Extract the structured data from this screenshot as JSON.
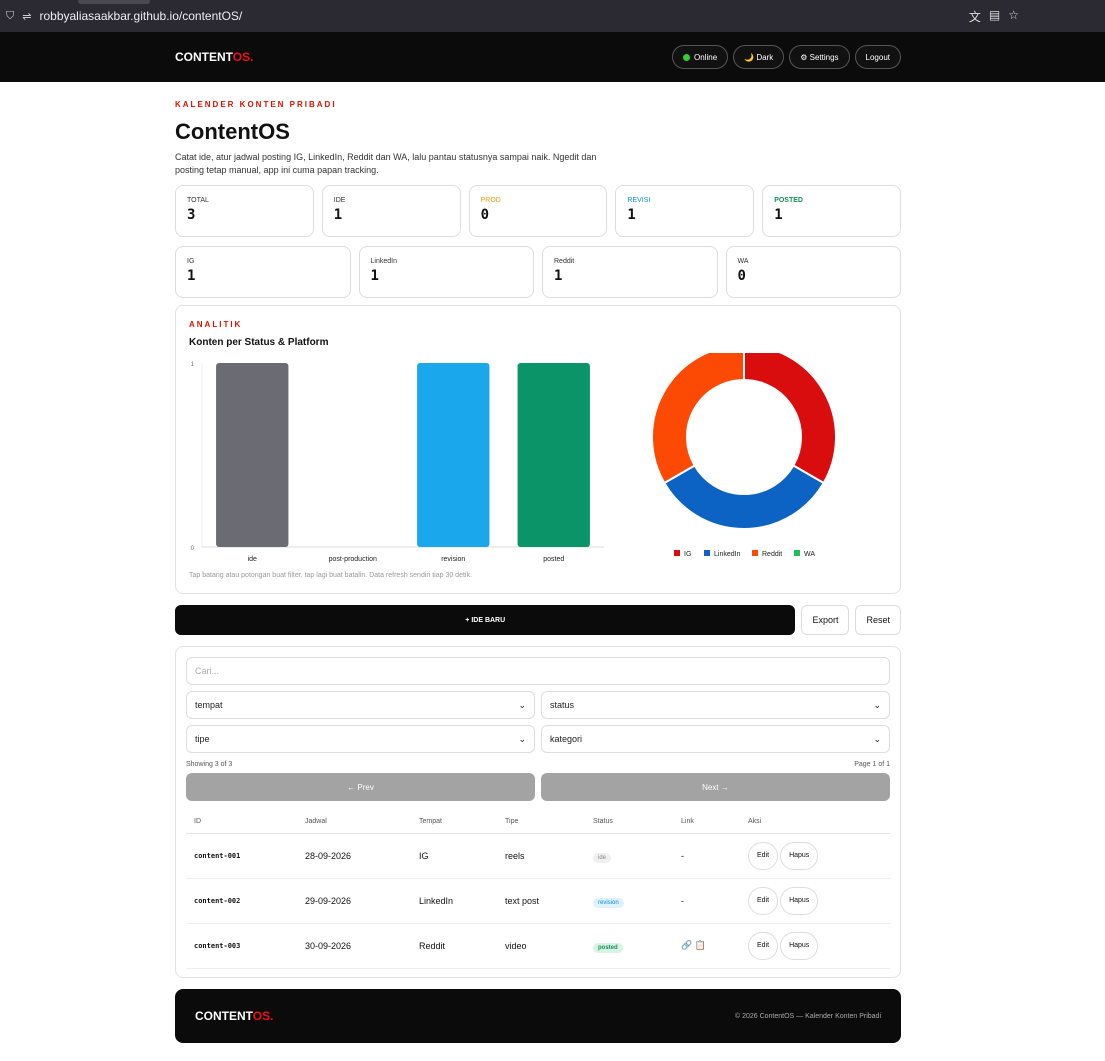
{
  "browser": {
    "url": "robbyaliasaakbar.github.io/contentOS/"
  },
  "nav": {
    "brand_main": "CONTENT",
    "brand_accent": "OS.",
    "online": "Online",
    "dark": "🌙 Dark",
    "settings": "⚙ Settings",
    "logout": "Logout"
  },
  "hero": {
    "eyebrow": "KALENDER KONTEN PRIBADI",
    "title": "ContentOS",
    "desc": "Catat ide, atur jadwal posting IG, LinkedIn, Reddit dan WA, lalu pantau statusnya sampai naik. Ngedit dan posting tetap manual, app ini cuma papan tracking."
  },
  "stats": [
    {
      "label": "TOTAL",
      "value": "3",
      "color": "#333333"
    },
    {
      "label": "IDE",
      "value": "1",
      "color": "#333333"
    },
    {
      "label": "PROD",
      "value": "0",
      "color": "#e89a0c"
    },
    {
      "label": "REVISI",
      "value": "1",
      "color": "#0b8fd4"
    },
    {
      "label": "POSTED",
      "value": "1",
      "color": "#149159"
    }
  ],
  "platform_stats": [
    {
      "label": "IG",
      "value": "1"
    },
    {
      "label": "LinkedIn",
      "value": "1"
    },
    {
      "label": "Reddit",
      "value": "1"
    },
    {
      "label": "WA",
      "value": "0"
    }
  ],
  "analytics": {
    "eyebrow": "ANALITIK",
    "title": "Konten per Status & Platform",
    "caption": "Tap batang atau potongan buat filter, tap lagi buat batalin. Data refresh sendiri tiap 30 detik."
  },
  "chart_data": [
    {
      "type": "bar",
      "categories": [
        "ide",
        "post-production",
        "revision",
        "posted"
      ],
      "values": [
        1,
        0,
        1,
        1
      ],
      "colors": [
        "#6b6b73",
        "#e89a0c",
        "#1aa7ec",
        "#0a9467"
      ],
      "ylim": [
        0,
        1
      ],
      "yticks": [
        "0",
        "1"
      ]
    },
    {
      "type": "pie",
      "donut": true,
      "categories": [
        "IG",
        "LinkedIn",
        "Reddit",
        "WA"
      ],
      "values": [
        1,
        1,
        1,
        0
      ],
      "colors": [
        "#d90d0d",
        "#0c63c4",
        "#fc4a05",
        "#1fbf55"
      ],
      "legend": "bottom"
    }
  ],
  "actions": {
    "new": "+ IDE BARU",
    "export": "Export",
    "reset": "Reset"
  },
  "filters": {
    "search_placeholder": "Cari...",
    "tempat": "tempat",
    "status": "status",
    "tipe": "tipe",
    "kategori": "kategori",
    "showing": "Showing 3 of 3",
    "page": "Page 1 of 1",
    "prev": "← Prev",
    "next": "Next →"
  },
  "table": {
    "headers": [
      "ID",
      "Jadwal",
      "Tempat",
      "Tipe",
      "Status",
      "Link",
      "Aksi"
    ],
    "rows": [
      {
        "id": "content-001",
        "jadwal": "28-09-2026",
        "tempat": "IG",
        "tipe": "reels",
        "status": "ide",
        "link": "-"
      },
      {
        "id": "content-002",
        "jadwal": "29-09-2026",
        "tempat": "LinkedIn",
        "tipe": "text post",
        "status": "revision",
        "link": "-"
      },
      {
        "id": "content-003",
        "jadwal": "30-09-2026",
        "tempat": "Reddit",
        "tipe": "video",
        "status": "posted",
        "link": "🔗 📋"
      }
    ],
    "edit": "Edit",
    "delete": "Hapus"
  },
  "footer": {
    "brand_main": "CONTENT",
    "brand_accent": "OS.",
    "copy": "© 2026 ContentOS — Kalender Konten Pribadi"
  }
}
